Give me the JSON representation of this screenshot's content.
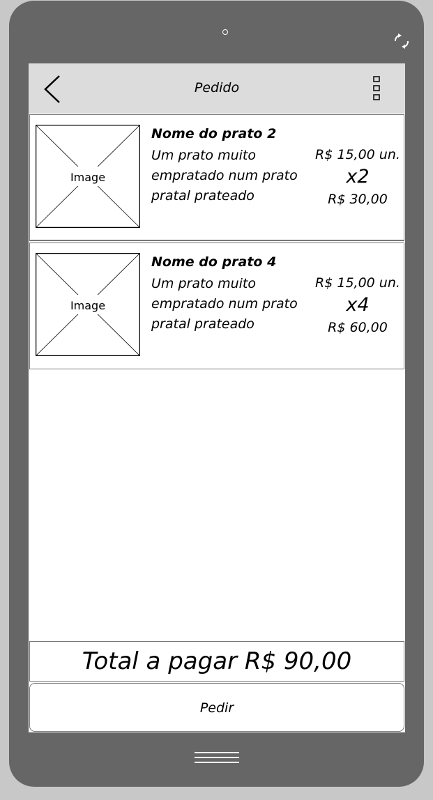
{
  "app_bar": {
    "title": "Pedido",
    "back_icon": "chevron-left-icon",
    "menu_icon": "vertical-menu-icon"
  },
  "device": {
    "rotate_icon": "rotate-icon",
    "home_icon": "home-lines-icon"
  },
  "items": [
    {
      "image_label": "Image",
      "name": "Nome do prato 2",
      "description": "Um prato muito empratado num prato pratal prateado",
      "unit_price": "R$ 15,00 un.",
      "quantity": "x2",
      "line_total": "R$ 30,00"
    },
    {
      "image_label": "Image",
      "name": "Nome do prato 4",
      "description": "Um prato muito empratado num prato pratal prateado",
      "unit_price": "R$ 15,00 un.",
      "quantity": "x4",
      "line_total": "R$ 60,00"
    }
  ],
  "total": {
    "label": "Total a pagar R$ 90,00"
  },
  "order_button": {
    "label": "Pedir"
  },
  "colors": {
    "device_body": "#666666",
    "app_bar": "#dcdcdc",
    "screen": "#ffffff",
    "background": "#c8c8c8"
  }
}
